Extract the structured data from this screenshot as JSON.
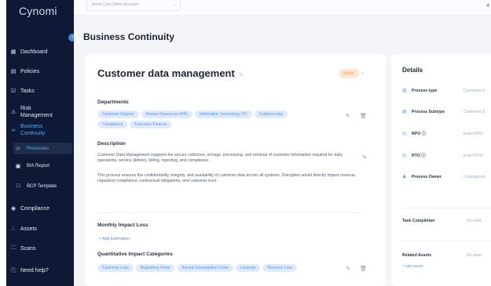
{
  "app": {
    "logo": "Cynomi"
  },
  "topbar": {
    "account": "Acme Corp Demo Account",
    "right_label": "4"
  },
  "sidebar": {
    "items": [
      {
        "label": "Dashboard",
        "icon": "grid-icon"
      },
      {
        "label": "Policies",
        "icon": "policies-icon"
      },
      {
        "label": "Tasks",
        "icon": "tasks-icon"
      },
      {
        "label": "Risk Management",
        "icon": "risk-icon"
      },
      {
        "label": "Business Continuity",
        "icon": "link-icon"
      },
      {
        "label": "Compliance",
        "icon": "compliance-icon"
      },
      {
        "label": "Assets",
        "icon": "assets-icon"
      },
      {
        "label": "Scans",
        "icon": "scans-icon"
      },
      {
        "label": "Need help?",
        "icon": "help-icon"
      }
    ],
    "sub_items": [
      {
        "label": "Processes",
        "icon": "processes-icon"
      },
      {
        "label": "BIA Report",
        "icon": "report-icon"
      },
      {
        "label": "BCP Template",
        "icon": "template-icon"
      }
    ]
  },
  "page": {
    "title": "Business Continuity"
  },
  "process": {
    "title": "Customer data management",
    "severity": "Major",
    "departments_label": "Departments",
    "departments": [
      "Customer Support",
      "Human Resources (HR)",
      "Information Technology (IT)",
      "Cybersecurity",
      "Compliance",
      "Executive Finance"
    ],
    "description_label": "Description",
    "description_p1": "Customer Data Management supports the secure collection, storage, processing, and retrieval of customer information required for daily operations, service delivery, billing, reporting, and compliance.",
    "description_p2": "This process ensures the confidentiality, integrity, and availability of customer data across all systems. Disruption would directly impact revenue, regulatory compliance, contractual obligations, and customer trust.",
    "monthly_label": "Monthly Impact Loss",
    "add_estimation": "+ Add Estimation",
    "quant_label": "Quantitative Impact Categories",
    "quant_tags": [
      "Customer Loss",
      "Regulatory Fines",
      "Breach Investigation Costs",
      "Lawsuits",
      "Revenue Loss"
    ]
  },
  "details": {
    "title": "Details",
    "rows": [
      {
        "label": "Process type",
        "value": "Customer E"
      },
      {
        "label": "Process Subtype",
        "value": "Customer S"
      },
      {
        "label": "RPO ⓘ",
        "value": "Enter RPO"
      },
      {
        "label": "RTO ⓘ",
        "value": "Enter RTO"
      },
      {
        "label": "Process Owner",
        "value": "Unassigned"
      }
    ],
    "task_completion_label": "Task Completion",
    "task_completion_value": "No relat",
    "related_assets_label": "Related Assets",
    "related_assets_value": "No asse",
    "add_assets": "+ Add Assets"
  }
}
